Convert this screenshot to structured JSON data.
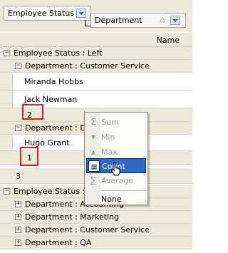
{
  "group_panel": {
    "chips": [
      {
        "label": "Employee Status",
        "sort_icon": "sort-triangle-icon",
        "filter_icon": "dropdown-icon"
      },
      {
        "label": "Department",
        "sort_icon": "sort-triangle-icon",
        "filter_icon": "dropdown-icon"
      }
    ]
  },
  "columns": {
    "name": "Name"
  },
  "grid": {
    "group_left": "Employee Status : Left",
    "dept_customer_service": "Department : Customer Service",
    "rows_customer_service": [
      "Miranda Hobbs",
      "Jack Newman"
    ],
    "count_customer_service": "2",
    "dept_dev": "Department : Dev",
    "rows_dev": [
      "Hugo Grant"
    ],
    "count_dev": "1",
    "count_left": "3",
    "group_active": "Employee Status : Ac",
    "dept_accounting": "Department : Accounting",
    "dept_marketing": "Department : Marketing",
    "dept_customer_service_2": "Department : Customer Service",
    "dept_qa": "Department : QA",
    "collapse_symbol": "−",
    "expand_symbol": "+"
  },
  "context_menu": {
    "items": [
      {
        "label": "Sum",
        "icon": "sum-icon",
        "glyph": "Σ",
        "enabled": false
      },
      {
        "label": "Min",
        "icon": "min-icon",
        "glyph": "▾",
        "enabled": false
      },
      {
        "label": "Max",
        "icon": "max-icon",
        "glyph": "▴",
        "enabled": false
      },
      {
        "label": "Count",
        "icon": "count-icon",
        "glyph": "≡",
        "enabled": true,
        "highlighted": true
      },
      {
        "label": "Average",
        "icon": "average-icon",
        "glyph": "∑",
        "enabled": false
      },
      {
        "label": "None",
        "icon": "",
        "glyph": "",
        "enabled": true
      }
    ]
  },
  "colors": {
    "menu_highlight": "#316ac5",
    "annotation_red": "#e02020",
    "group_background": "#ece9d8"
  }
}
